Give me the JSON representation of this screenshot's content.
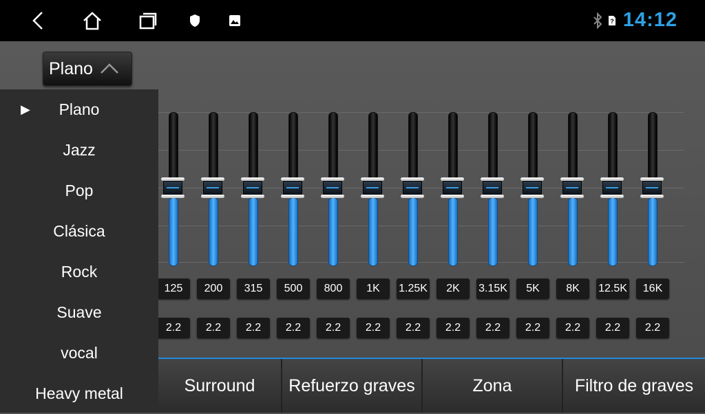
{
  "status_bar": {
    "icons": [
      "back-icon",
      "home-icon",
      "recent-apps-icon",
      "shield-icon",
      "image-icon",
      "bluetooth-icon",
      "sim-icon"
    ],
    "time": "14:12"
  },
  "preset": {
    "selected": "Plano"
  },
  "menu": {
    "items": [
      "Plano",
      "Jazz",
      "Pop",
      "Clásica",
      "Rock",
      "Suave",
      "vocal",
      "Heavy metal"
    ],
    "selected_index": 0
  },
  "bands": [
    {
      "freq": "125",
      "value": "2.2"
    },
    {
      "freq": "200",
      "value": "2.2"
    },
    {
      "freq": "315",
      "value": "2.2"
    },
    {
      "freq": "500",
      "value": "2.2"
    },
    {
      "freq": "800",
      "value": "2.2"
    },
    {
      "freq": "1K",
      "value": "2.2"
    },
    {
      "freq": "1.25K",
      "value": "2.2"
    },
    {
      "freq": "2K",
      "value": "2.2"
    },
    {
      "freq": "3.15K",
      "value": "2.2"
    },
    {
      "freq": "5K",
      "value": "2.2"
    },
    {
      "freq": "8K",
      "value": "2.2"
    },
    {
      "freq": "12.5K",
      "value": "2.2"
    },
    {
      "freq": "16K",
      "value": "2.2"
    }
  ],
  "bottom_tabs": [
    "Surround",
    "Refuerzo graves",
    "Zona",
    "Filtro de graves"
  ],
  "colors": {
    "accent": "#2ea2e6",
    "slider_fill": "#4fb4ff"
  }
}
